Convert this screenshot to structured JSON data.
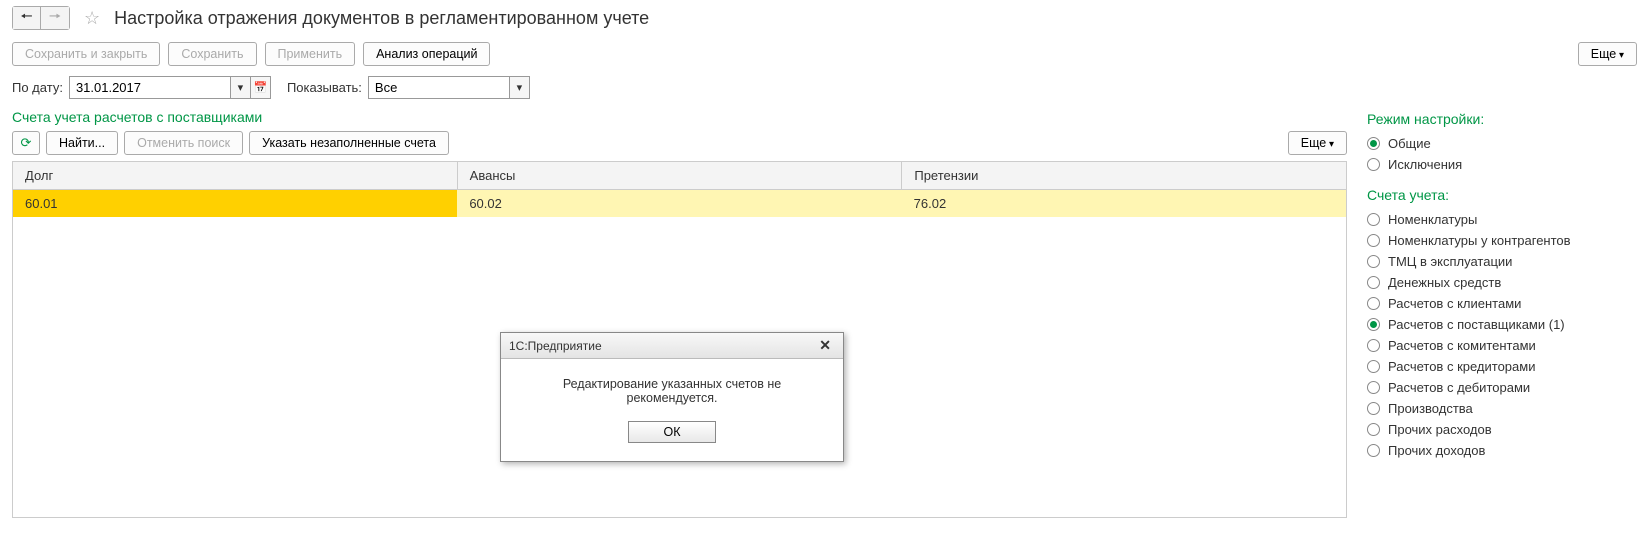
{
  "header": {
    "title": "Настройка отражения документов в регламентированном учете"
  },
  "toolbar": {
    "save_close": "Сохранить и закрыть",
    "save": "Сохранить",
    "apply": "Применить",
    "analyze": "Анализ операций",
    "more": "Еще"
  },
  "filter": {
    "date_label": "По дату:",
    "date_value": "31.01.2017",
    "show_label": "Показывать:",
    "show_value": "Все"
  },
  "section": {
    "title": "Счета учета расчетов с поставщиками",
    "find": "Найти...",
    "cancel_search": "Отменить поиск",
    "specify_empty": "Указать незаполненные счета",
    "more": "Еще"
  },
  "grid": {
    "headers": [
      "Долг",
      "Авансы",
      "Претензии"
    ],
    "row": [
      "60.01",
      "60.02",
      "76.02"
    ]
  },
  "right": {
    "mode_title": "Режим настройки:",
    "mode_options": [
      {
        "label": "Общие",
        "checked": true
      },
      {
        "label": "Исключения",
        "checked": false
      }
    ],
    "accounts_title": "Счета учета:",
    "accounts_options": [
      {
        "label": "Номенклатуры",
        "checked": false
      },
      {
        "label": "Номенклатуры у контрагентов",
        "checked": false
      },
      {
        "label": "ТМЦ в эксплуатации",
        "checked": false
      },
      {
        "label": "Денежных средств",
        "checked": false
      },
      {
        "label": "Расчетов с клиентами",
        "checked": false
      },
      {
        "label": "Расчетов с поставщиками (1)",
        "checked": true
      },
      {
        "label": "Расчетов с комитентами",
        "checked": false
      },
      {
        "label": "Расчетов с кредиторами",
        "checked": false
      },
      {
        "label": "Расчетов с дебиторами",
        "checked": false
      },
      {
        "label": "Производства",
        "checked": false
      },
      {
        "label": "Прочих расходов",
        "checked": false
      },
      {
        "label": "Прочих доходов",
        "checked": false
      }
    ]
  },
  "dialog": {
    "title": "1С:Предприятие",
    "message": "Редактирование указанных счетов не рекомендуется.",
    "ok": "ОК"
  }
}
